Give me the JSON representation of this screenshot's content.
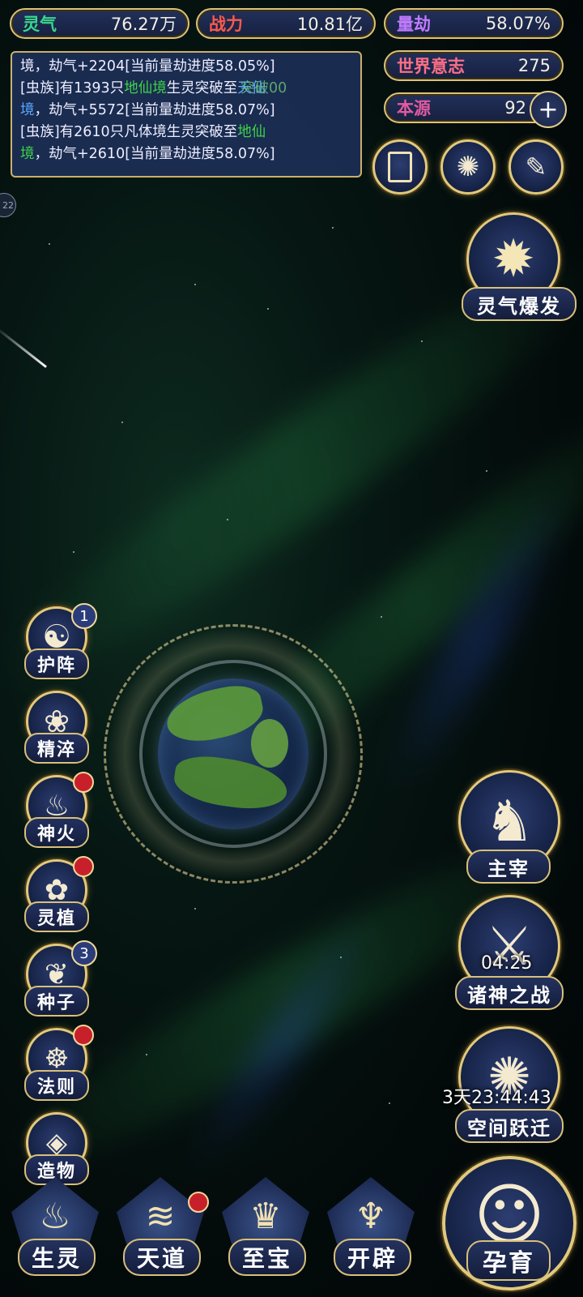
{
  "stats": {
    "lingqi": {
      "label": "灵气",
      "value": "76.27万"
    },
    "zhanli": {
      "label": "战力",
      "value": "10.81亿"
    },
    "liangjie": {
      "label": "量劫",
      "value": "58.07%"
    },
    "world_will": {
      "label": "世界意志",
      "value": "275"
    },
    "benyuan": {
      "label": "本源",
      "value": "92",
      "plus": "+"
    }
  },
  "colors": {
    "lingqi_label": "#39d88a",
    "zhanli_label": "#ff5a4a",
    "liangjie_label": "#c07bff",
    "world_label": "#ff6f86",
    "benyuan_label": "#e25aa0",
    "accent_gold": "#d9c27a",
    "green_realm": "#3fd24a",
    "blue_realm": "#5aa8ff",
    "badge_red": "#c8202a"
  },
  "log": {
    "line1_pre": "境，劫气+2204[当前量劫进度58.05%]",
    "line2_a": "[虫族]有1393只",
    "line2_realm_from": "地仙境",
    "line2_b": "生灵突破至",
    "line2_realm_to": "天仙",
    "line3_a": "境",
    "line3_b": "，劫气+5572[当前量劫进度58.07%]",
    "line4_a": "[虫族]有2610只凡体境生灵突破至",
    "line4_realm_to": "地仙",
    "line5_a": "境",
    "line5_b": "，劫气+2610[当前量劫进度58.07%]",
    "overlay_text": "突破00"
  },
  "top_icons": [
    "card-icon",
    "vortex-icon",
    "scroll-icon"
  ],
  "burst": {
    "label": "灵气爆发"
  },
  "left_menu": [
    {
      "label": "护阵",
      "icon": "yin-yang-icon",
      "badge": "1"
    },
    {
      "label": "精淬",
      "icon": "lotus-icon"
    },
    {
      "label": "神火",
      "icon": "flame-icon",
      "dot": true
    },
    {
      "label": "灵植",
      "icon": "plant-icon",
      "dot": true
    },
    {
      "label": "种子",
      "icon": "seed-icon",
      "badge": "3"
    },
    {
      "label": "法则",
      "icon": "rune-icon",
      "dot": true
    },
    {
      "label": "造物",
      "icon": "creation-icon"
    }
  ],
  "right_menu": [
    {
      "label": "主宰",
      "icon": "dragon-icon"
    },
    {
      "label": "诸神之战",
      "icon": "sword-icon",
      "timer": "04:25"
    },
    {
      "label": "空间跃迁",
      "icon": "portal-icon",
      "timer": "3天23:44:43"
    }
  ],
  "bottom_menu": [
    {
      "label": "生灵",
      "icon": "phoenix-icon"
    },
    {
      "label": "天道",
      "icon": "wave-icon",
      "dot": true
    },
    {
      "label": "至宝",
      "icon": "treasure-icon"
    },
    {
      "label": "开辟",
      "icon": "flame-crest-icon"
    }
  ],
  "main_action": {
    "label": "孕育",
    "icon": "embryo-icon"
  },
  "side_tab": "22"
}
